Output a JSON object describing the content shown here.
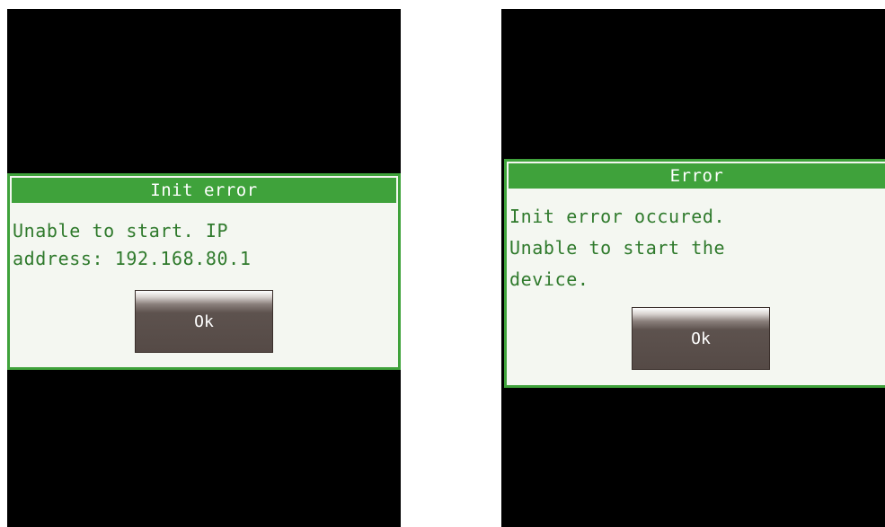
{
  "left_screen": {
    "dialog": {
      "title": "Init error",
      "message": "Unable to start. IP\naddress: 192.168.80.1",
      "ok_label": "Ok"
    }
  },
  "right_screen": {
    "dialog": {
      "title": "Error",
      "message": "Init error occured.\nUnable to start the\ndevice.",
      "ok_label": "Ok"
    }
  },
  "colors": {
    "screen_background": "#000000",
    "dialog_border": "#3fa23b",
    "dialog_background": "#f4f7f1",
    "message_text": "#2f7a2c",
    "title_text": "#ffffff"
  }
}
